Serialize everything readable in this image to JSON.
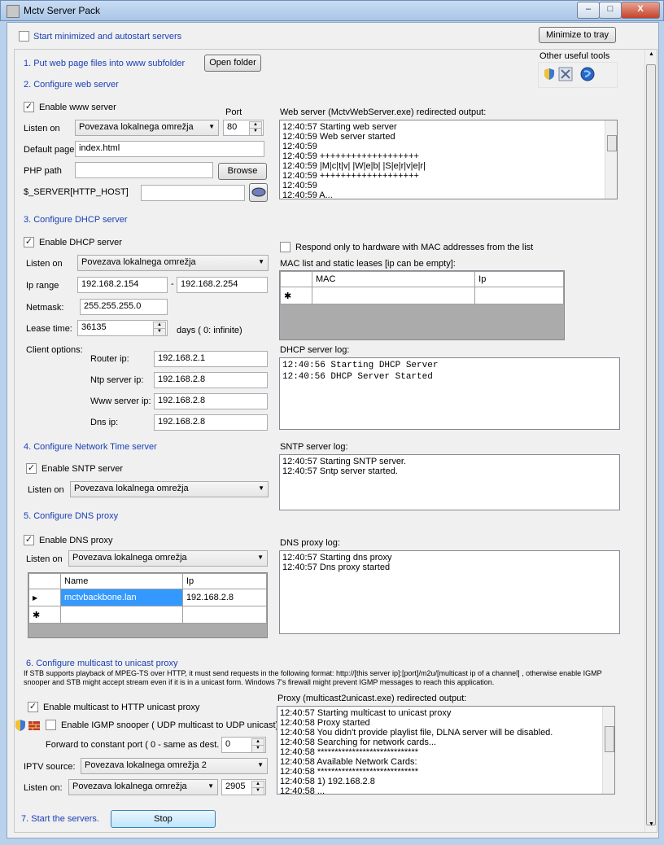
{
  "window": {
    "title": "Mctv Server Pack",
    "btn_min": "–",
    "btn_max": "□",
    "btn_close": "X"
  },
  "top": {
    "start_minimized": "Start minimized and autostart servers",
    "minimize_tray": "Minimize to tray"
  },
  "step1": {
    "label": "1. Put web page files into www subfolder",
    "open_folder": "Open folder"
  },
  "tools": {
    "title": "Other useful tools"
  },
  "web": {
    "heading": "2. Configure web server",
    "enable": "Enable www server",
    "port_label": "Port",
    "port": "80",
    "listen_label": "Listen on",
    "listen_value": "Povezava lokalnega omrežja",
    "default_page_label": "Default page",
    "default_page": "index.html",
    "php_label": "PHP path",
    "php_value": "",
    "browse": "Browse",
    "server_host_label": "$_SERVER[HTTP_HOST]",
    "server_host_value": "",
    "output_label": "Web server (MctvWebServer.exe) redirected output:",
    "log": [
      "12:40:57 Starting web server",
      "12:40:59 Web server started",
      "12:40:59",
      "12:40:59 +++++++++++++++++++",
      "12:40:59 |M|c|t|v| |W|e|b| |S|e|r|v|e|r|",
      "12:40:59 +++++++++++++++++++",
      "12:40:59",
      "12:40:59 A..."
    ]
  },
  "dhcp": {
    "heading": "3. Configure DHCP server",
    "enable": "Enable DHCP server",
    "listen_label": "Listen on",
    "listen_value": "Povezava lokalnega omrežja",
    "ip_range_label": "Ip range",
    "ip_from": "192.168.2.154",
    "ip_dash": "-",
    "ip_to": "192.168.2.254",
    "netmask_label": "Netmask:",
    "netmask": "255.255.255.0",
    "lease_label": "Lease time:",
    "lease": "36135",
    "days_label": "days  ( 0: infinite)",
    "client_options_label": "Client options:",
    "router_label": "Router ip:",
    "router": "192.168.2.1",
    "ntp_label": "Ntp server ip:",
    "ntp": "192.168.2.8",
    "www_label": "Www server ip:",
    "www": "192.168.2.8",
    "dns_label": "Dns ip:",
    "dns": "192.168.2.8",
    "mac_only": "Respond only to hardware with MAC addresses from the list",
    "mac_list_label": "MAC list and static leases [ip can be empty]:",
    "col_mac": "MAC",
    "col_ip": "Ip",
    "new_row": "✱",
    "log_label": "DHCP server log:",
    "log": [
      "12:40:56 Starting DHCP Server",
      "12:40:56 DHCP Server Started"
    ]
  },
  "sntp": {
    "heading": "4. Configure Network Time server",
    "enable": "Enable SNTP server",
    "listen_label": "Listen on",
    "listen_value": "Povezava lokalnega omrežja",
    "log_label": "SNTP server log:",
    "log": [
      "12:40:57 Starting SNTP server.",
      "12:40:57 Sntp server started."
    ]
  },
  "dns": {
    "heading": "5. Configure DNS proxy",
    "enable": "Enable DNS proxy",
    "listen_label": "Listen on",
    "listen_value": "Povezava lokalnega omrežja",
    "col_name": "Name",
    "col_ip": "Ip",
    "row_marker": "▶",
    "new_row": "✱",
    "rows": [
      {
        "name": "mctvbackbone.lan",
        "ip": "192.168.2.8"
      }
    ],
    "log_label": "DNS proxy log:",
    "log": [
      "12:40:57 Starting dns proxy",
      "12:40:57 Dns proxy started"
    ]
  },
  "mcast": {
    "heading": "6. Configure multicast to unicast proxy",
    "desc": "If STB supports playback of MPEG-TS over HTTP, it must send requests in the following format: http://[this server ip]:[port]/m2u/[multicast ip of a channel] , otherwise enable IGMP snooper and STB might accept stream even if it is in a unicast form. Windows 7's firewall might prevent IGMP messages to reach this application.",
    "enable": "Enable multicast to HTTP unicast proxy",
    "igmp": "Enable IGMP snooper ( UDP multicast to UDP unicast)",
    "forward_label": "Forward to constant port ( 0 - same as dest. )",
    "forward_port": "0",
    "iptv_label": "IPTV source:",
    "iptv_value": "Povezava lokalnega omrežja 2",
    "listen_label": "Listen on:",
    "listen_value": "Povezava lokalnega omrežja",
    "listen_port": "2905",
    "output_label": "Proxy (multicast2unicast.exe) redirected output:",
    "log": [
      "12:40:57 Starting multicast to unicast proxy",
      "12:40:58 Proxy started",
      "12:40:58 You didn't provide playlist file, DLNA server will be disabled.",
      "12:40:58 Searching for network cards...",
      "12:40:58 *****************************",
      "12:40:58 Available Network Cards:",
      "12:40:58 *****************************",
      "12:40:58 1) 192.168.2.8",
      "12:40:58 ..."
    ]
  },
  "step7": {
    "label": "7. Start the servers.",
    "stop": "Stop"
  },
  "colors": {
    "heading_blue": "#1a3fb5",
    "selection": "#3399ff"
  }
}
